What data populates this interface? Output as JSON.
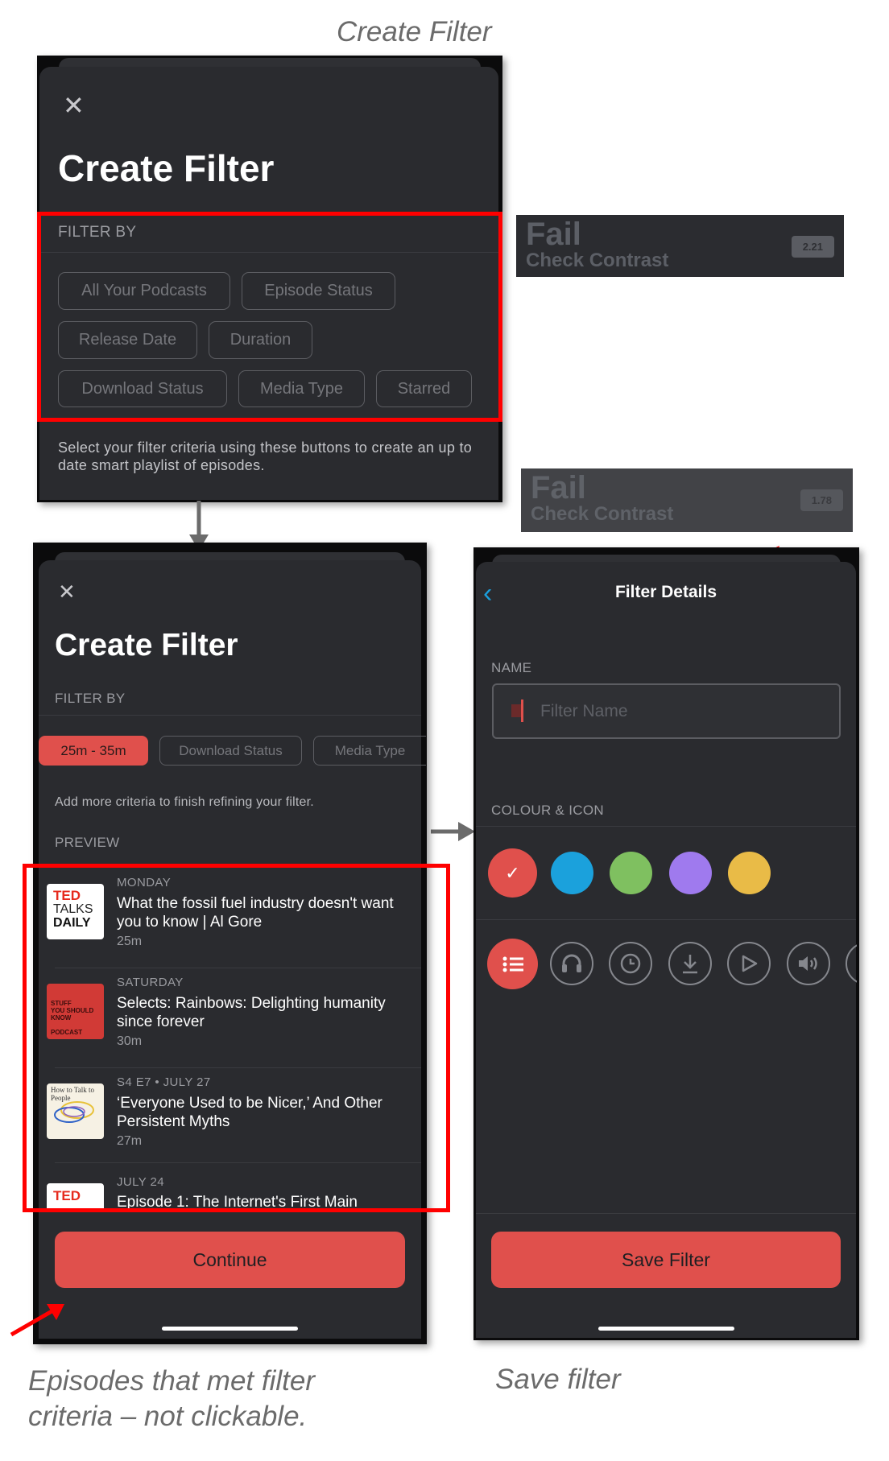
{
  "captions": {
    "top": "Create Filter",
    "left": "Episodes that met filter criteria – not clickable.",
    "left_line1": "Episodes that met filter",
    "left_line2": "criteria – not clickable.",
    "right": "Save filter"
  },
  "contrast_checks": [
    {
      "result": "Fail",
      "note": "Check Contrast",
      "ratio": "2.21"
    },
    {
      "result": "Fail",
      "note": "Check Contrast",
      "ratio": "1.78"
    }
  ],
  "screen1": {
    "title": "Create Filter",
    "section": "FILTER BY",
    "chips": [
      "All Your Podcasts",
      "Episode Status",
      "Release Date",
      "Duration",
      "Download Status",
      "Media Type",
      "Starred"
    ],
    "description": "Select your filter criteria using these buttons to create an up to date smart playlist of episodes."
  },
  "screen2": {
    "title": "Create Filter",
    "section": "FILTER BY",
    "chips": [
      "25m - 35m",
      "Download Status",
      "Media Type"
    ],
    "hint": "Add more criteria to finish refining your filter.",
    "preview_label": "PREVIEW",
    "episodes": [
      {
        "date": "MONDAY",
        "title": "What the fossil fuel industry doesn't want you to know | Al Gore",
        "duration": "25m",
        "art": "TED TALKS DAILY"
      },
      {
        "date": "SATURDAY",
        "title": "Selects: Rainbows: Delighting humanity since forever",
        "duration": "30m",
        "art": "STUFF YOU SHOULD KNOW PODCAST"
      },
      {
        "date": "S4 E7 • JULY 27",
        "title": "‘Everyone Used to be Nicer,’ And Other Persistent Myths",
        "duration": "27m",
        "art": "How to Talk to People"
      },
      {
        "date": "JULY 24",
        "title": "Episode 1: The Internet's First Main",
        "duration": "",
        "art": "TED TALKS"
      }
    ],
    "continue_label": "Continue"
  },
  "screen3": {
    "title": "Filter Details",
    "name_label": "NAME",
    "name_placeholder": "Filter Name",
    "colour_label": "COLOUR & ICON",
    "colors": [
      "#e0504c",
      "#1ba1dc",
      "#7fc060",
      "#9f7aee",
      "#e9bb47"
    ],
    "selected_color": 0,
    "icons": [
      "list-icon",
      "headphones-icon",
      "clock-icon",
      "download-icon",
      "play-icon",
      "speaker-icon"
    ],
    "selected_icon": 0,
    "save_label": "Save Filter",
    "accent": "#1a9fdd"
  }
}
